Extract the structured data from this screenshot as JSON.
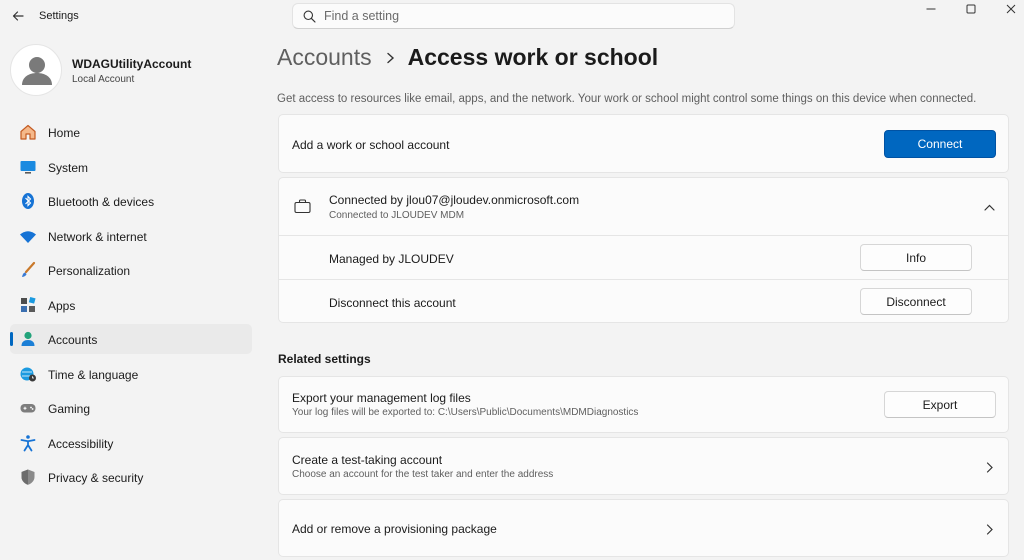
{
  "window": {
    "title": "Settings",
    "search_placeholder": "Find a setting"
  },
  "profile": {
    "name": "WDAGUtilityAccount",
    "subtitle": "Local Account"
  },
  "nav": {
    "items": [
      {
        "label": "Home",
        "icon": "home-icon"
      },
      {
        "label": "System",
        "icon": "system-icon"
      },
      {
        "label": "Bluetooth & devices",
        "icon": "bluetooth-icon"
      },
      {
        "label": "Network & internet",
        "icon": "wifi-icon"
      },
      {
        "label": "Personalization",
        "icon": "brush-icon"
      },
      {
        "label": "Apps",
        "icon": "apps-icon"
      },
      {
        "label": "Accounts",
        "icon": "accounts-icon",
        "selected": true
      },
      {
        "label": "Time & language",
        "icon": "globe-clock-icon"
      },
      {
        "label": "Gaming",
        "icon": "gamepad-icon"
      },
      {
        "label": "Accessibility",
        "icon": "accessibility-icon"
      },
      {
        "label": "Privacy & security",
        "icon": "shield-icon"
      }
    ]
  },
  "header": {
    "parent": "Accounts",
    "current": "Access work or school",
    "description": "Get access to resources like email, apps, and the network. Your work or school might control some things on this device when connected."
  },
  "add_account": {
    "label": "Add a work or school account",
    "button": "Connect"
  },
  "connection": {
    "title": "Connected by jlou07@jloudev.onmicrosoft.com",
    "subtitle": "Connected to JLOUDEV MDM",
    "managed_label": "Managed by JLOUDEV",
    "info_button": "Info",
    "disconnect_label": "Disconnect this account",
    "disconnect_button": "Disconnect"
  },
  "related": {
    "title": "Related settings",
    "export_title": "Export your management log files",
    "export_sub": "Your log files will be exported to: C:\\Users\\Public\\Documents\\MDMDiagnostics",
    "export_button": "Export",
    "test_title": "Create a test-taking account",
    "test_sub": "Choose an account for the test taker and enter the address",
    "provision_title": "Add or remove a provisioning package"
  },
  "colors": {
    "accent": "#0067c0",
    "background": "#f3f3f3",
    "card": "#fbfbfb"
  }
}
